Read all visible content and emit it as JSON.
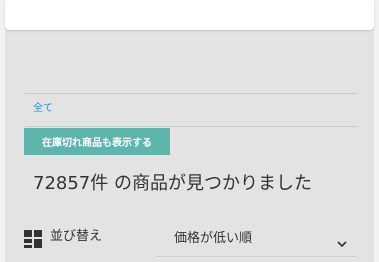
{
  "filters": {
    "category_link": "全て",
    "stock_toggle_label": "在庫切れ商品も表示する"
  },
  "results": {
    "count_text": "72857件  の商品が見つかりました"
  },
  "sort": {
    "label": "並び替え",
    "selected": "価格が低い順",
    "icon": "grid-sort-icon"
  },
  "colors": {
    "background": "#e3e3e3",
    "toggle_bg": "#5db5ac",
    "link": "#2a8dc8"
  }
}
